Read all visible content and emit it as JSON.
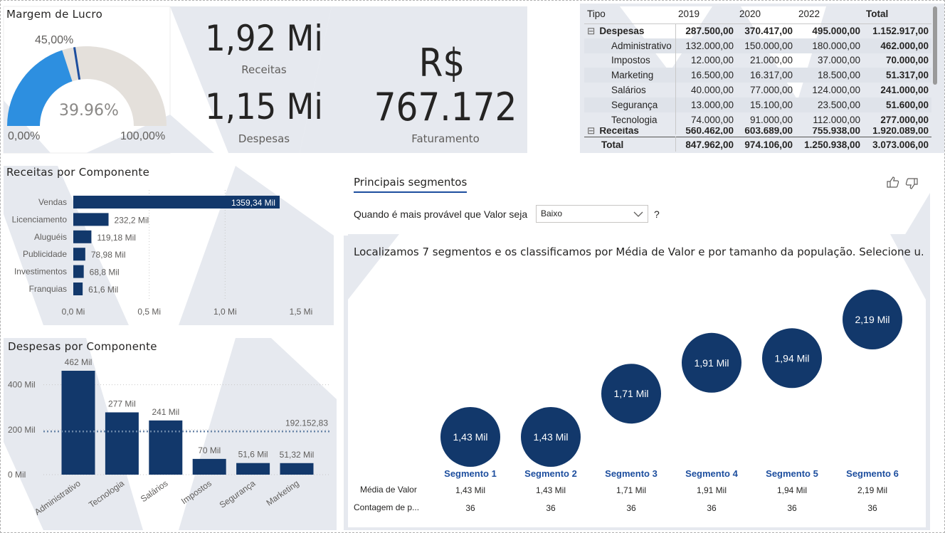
{
  "gauge": {
    "title": "Margem de Lucro",
    "target_label": "45,00%",
    "value_label": "39.96%",
    "min_label": "0,00%",
    "max_label": "100,00%",
    "value": 0.3996,
    "target": 0.45,
    "colors": {
      "fill": "#2d8fe0",
      "track": "#e4e0db",
      "target": "#1d4e9e"
    }
  },
  "kpi": {
    "receitas_value": "1,92 Mi",
    "receitas_label": "Receitas",
    "despesas_value": "1,15 Mi",
    "despesas_label": "Despesas",
    "faturamento_currency": "R$",
    "faturamento_value": "767.172",
    "faturamento_label": "Faturamento"
  },
  "matrix": {
    "headers": [
      "Tipo",
      "2019",
      "2020",
      "2022",
      "Total"
    ],
    "group": {
      "expander": "⊟",
      "label": "Despesas",
      "values": [
        "287.500,00",
        "370.417,00",
        "495.000,00",
        "1.152.917,00"
      ]
    },
    "rows": [
      {
        "label": "Administrativo",
        "values": [
          "132.000,00",
          "150.000,00",
          "180.000,00",
          "462.000,00"
        ]
      },
      {
        "label": "Impostos",
        "values": [
          "12.000,00",
          "21.000,00",
          "37.000,00",
          "70.000,00"
        ]
      },
      {
        "label": "Marketing",
        "values": [
          "16.500,00",
          "16.317,00",
          "18.500,00",
          "51.317,00"
        ]
      },
      {
        "label": "Salários",
        "values": [
          "40.000,00",
          "77.000,00",
          "124.000,00",
          "241.000,00"
        ]
      },
      {
        "label": "Segurança",
        "values": [
          "13.000,00",
          "15.100,00",
          "23.500,00",
          "51.600,00"
        ]
      },
      {
        "label": "Tecnologia",
        "values": [
          "74.000,00",
          "91.000,00",
          "112.000,00",
          "277.000,00"
        ]
      }
    ],
    "partial_row": {
      "label": "Receitas",
      "values": [
        "560.462,00",
        "603.689,00",
        "755.938,00",
        "1.920.089,00"
      ]
    },
    "total": {
      "label": "Total",
      "values": [
        "847.962,00",
        "974.106,00",
        "1.250.938,00",
        "3.073.006,00"
      ]
    }
  },
  "receitas_chart": {
    "title": "Receitas por Componente",
    "x_ticks": [
      "0,0 Mi",
      "0,5 Mi",
      "1,0 Mi",
      "1,5 Mi"
    ]
  },
  "despesas_chart": {
    "title": "Despesas por Componente",
    "y_ticks": [
      "0 Mil",
      "200 Mil",
      "400 Mil"
    ],
    "avg_label": "192.152,83"
  },
  "chart_data": [
    {
      "type": "bar",
      "orientation": "horizontal",
      "title": "Receitas por Componente",
      "categories": [
        "Vendas",
        "Licenciamento",
        "Aluguéis",
        "Publicidade",
        "Investimentos",
        "Franquias"
      ],
      "values": [
        1359.34,
        232.2,
        119.18,
        78.98,
        68.8,
        61.6
      ],
      "data_labels": [
        "1359,34 Mil",
        "232,2 Mil",
        "119,18 Mil",
        "78,98 Mil",
        "68,8 Mil",
        "61,6 Mil"
      ],
      "xlim": [
        0,
        1500
      ],
      "grid": true,
      "color": "#12386b"
    },
    {
      "type": "bar",
      "title": "Despesas por Componente",
      "categories": [
        "Administrativo",
        "Tecnologia",
        "Salários",
        "Impostos",
        "Segurança",
        "Marketing"
      ],
      "values": [
        462,
        277,
        241,
        70,
        51.6,
        51.32
      ],
      "data_labels": [
        "462 Mil",
        "277 Mil",
        "241 Mil",
        "70 Mil",
        "51,6 Mil",
        "51,32 Mil"
      ],
      "ylim": [
        0,
        500
      ],
      "average_line": 192.15283,
      "grid": true,
      "color": "#12386b"
    }
  ],
  "segments": {
    "tab_label": "Principais segmentos",
    "question_prefix": "Quando é mais provável que Valor seja",
    "dropdown_value": "Baixo",
    "question_suffix": "?",
    "summary": "Localizamos 7 segmentos e os classificamos por Média de Valor e por tamanho da população. Selecione u...",
    "row_label_media": "Média de Valor",
    "row_label_contagem": "Contagem de p...",
    "items": [
      {
        "name": "Segmento 1",
        "bubble_label": "1,43 Mil",
        "media": "1,43 Mil",
        "contagem": "36",
        "value": 1.43
      },
      {
        "name": "Segmento 2",
        "bubble_label": "1,43 Mil",
        "media": "1,43 Mil",
        "contagem": "36",
        "value": 1.43
      },
      {
        "name": "Segmento 3",
        "bubble_label": "1,71 Mil",
        "media": "1,71 Mil",
        "contagem": "36",
        "value": 1.71
      },
      {
        "name": "Segmento 4",
        "bubble_label": "1,91 Mil",
        "media": "1,91 Mil",
        "contagem": "36",
        "value": 1.91
      },
      {
        "name": "Segmento 5",
        "bubble_label": "1,94 Mil",
        "media": "1,94 Mil",
        "contagem": "36",
        "value": 1.94
      },
      {
        "name": "Segmento 6",
        "bubble_label": "2,19 Mil",
        "media": "2,19 Mil",
        "contagem": "36",
        "value": 2.19
      }
    ],
    "bubble_color": "#12386b",
    "name_color": "#1d4e9e"
  },
  "icons": {
    "thumbs_up": "thumbs-up-icon",
    "thumbs_down": "thumbs-down-icon",
    "chevron": "chevron-down-icon"
  }
}
